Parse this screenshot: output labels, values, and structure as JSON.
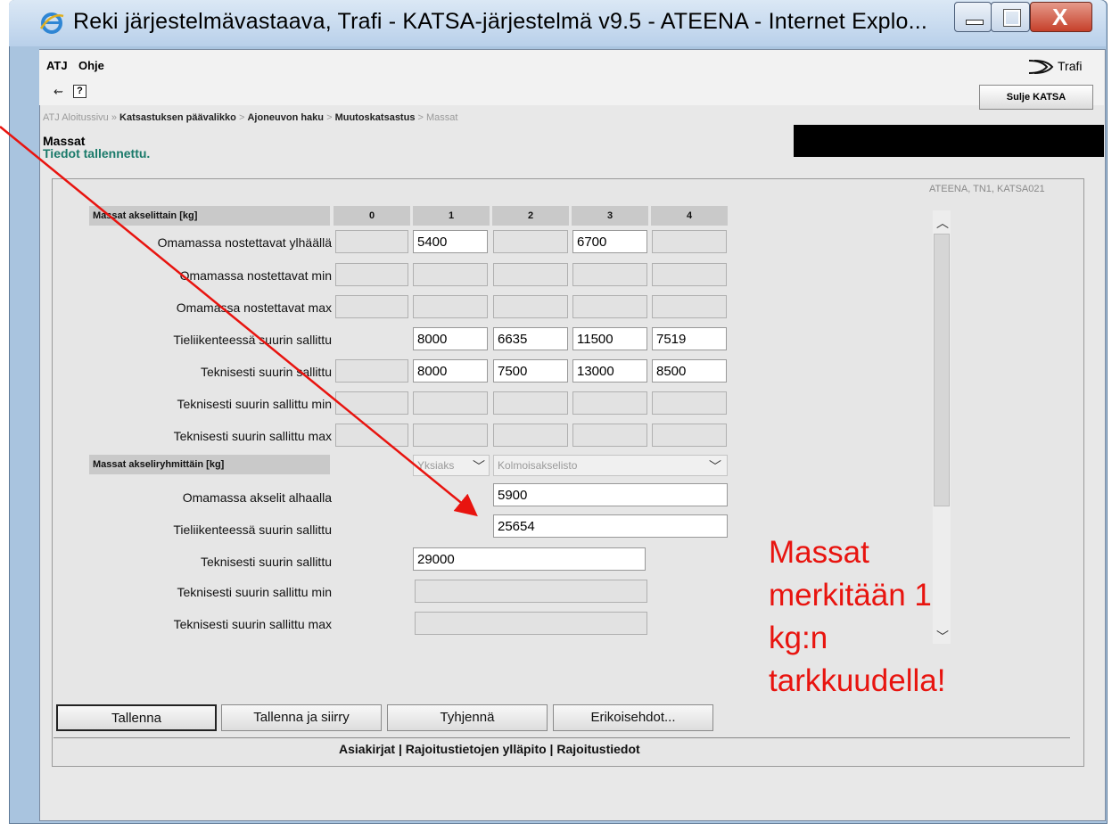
{
  "window": {
    "title": "Reki järjestelmävastaava, Trafi - KATSA-järjestelmä v9.5 - ATEENA - Internet Explo..."
  },
  "menu": {
    "items": [
      "ATJ",
      "Ohje"
    ],
    "logo": "Trafi"
  },
  "toolbar": {
    "close_label": "Sulje KATSA",
    "help_label": "?"
  },
  "breadcrumb": {
    "items": [
      "ATJ Aloitussivu",
      "Katsastuksen päävalikko",
      "Ajoneuvon haku",
      "Muutoskatsastus",
      "Massat"
    ],
    "sep_first": "»",
    "sep": ">"
  },
  "page": {
    "title": "Massat",
    "status": "Tiedot tallennettu.",
    "session": "ATEENA, TN1, KATSA021"
  },
  "axle_table": {
    "header": "Massat akselittain [kg]",
    "columns": [
      "0",
      "1",
      "2",
      "3",
      "4"
    ],
    "rows": [
      {
        "label": "Omamassa nostettavat ylhäällä",
        "values": [
          "",
          "5400",
          "",
          "6700",
          ""
        ]
      },
      {
        "label": "Omamassa nostettavat min",
        "values": [
          "",
          "",
          "",
          "",
          ""
        ]
      },
      {
        "label": "Omamassa nostettavat max",
        "values": [
          "",
          "",
          "",
          "",
          ""
        ]
      },
      {
        "label": "Tieliikenteessä suurin sallittu",
        "values": [
          "",
          "8000",
          "6635",
          "11500",
          "7519"
        ]
      },
      {
        "label": "Teknisesti suurin sallittu",
        "values": [
          "",
          "8000",
          "7500",
          "13000",
          "8500"
        ]
      },
      {
        "label": "Teknisesti suurin sallittu min",
        "values": [
          "",
          "",
          "",
          "",
          ""
        ]
      },
      {
        "label": "Teknisesti suurin sallittu max",
        "values": [
          "",
          "",
          "",
          "",
          ""
        ]
      }
    ]
  },
  "group_table": {
    "header": "Massat akseliryhmittäin [kg]",
    "select1": "Yksiaks",
    "select2": "Kolmoisakselisto",
    "rows": [
      {
        "label": "Omamassa akselit alhaalla",
        "value": "5900"
      },
      {
        "label": "Tieliikenteessä suurin sallittu",
        "value": "25654"
      },
      {
        "label": "Teknisesti suurin sallittu",
        "value": "29000"
      },
      {
        "label": "Teknisesti suurin sallittu min",
        "value": ""
      },
      {
        "label": "Teknisesti suurin sallittu max",
        "value": ""
      }
    ]
  },
  "buttons": {
    "save": "Tallenna",
    "save_next": "Tallenna ja siirry",
    "clear": "Tyhjennä",
    "special": "Erikoisehdot..."
  },
  "footer": {
    "links": [
      "Asiakirjat",
      "Rajoitustietojen ylläpito",
      "Rajoitustiedot"
    ],
    "sep": "|"
  },
  "annotation": {
    "lines": [
      "Massat",
      "merkitään 1",
      "kg:n",
      "tarkkuudella!"
    ],
    "color": "#e8140f"
  },
  "colors": {
    "status": "#1a7a6a",
    "annotation": "#e8140f"
  }
}
